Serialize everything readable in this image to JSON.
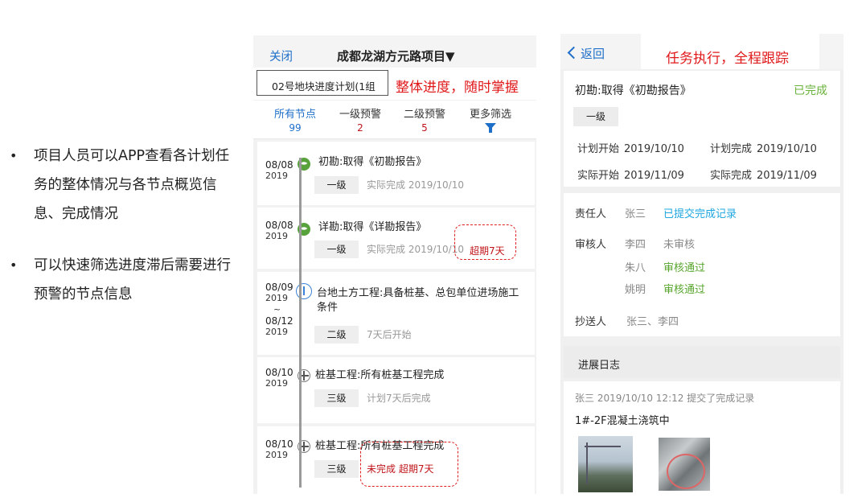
{
  "bullets": [
    {
      "text": "项目人员可以APP查看各计划任务的整体情况与各节点概览信息、完成情况"
    },
    {
      "text": "可以快速筛选进度滞后需要进行预警的节点信息"
    }
  ],
  "phone1": {
    "close": "关闭",
    "project_title": "成都龙湖方元路项目▼",
    "plan_select": "02号地块进度计划(1组",
    "callout": "整体进度，随时掌握",
    "filters": [
      {
        "label": "所有节点",
        "count": "99"
      },
      {
        "label": "一级预警",
        "count": "2"
      },
      {
        "label": "二级预警",
        "count": "5"
      },
      {
        "label": "更多筛选"
      }
    ],
    "tasks": [
      {
        "date": "08/08",
        "year": "2019",
        "name": "初勘:取得《初勘报告》",
        "level": "一级",
        "status": "实际完成 2019/10/10"
      },
      {
        "date": "08/08",
        "year": "2019",
        "name": "详勘:取得《详勘报告》",
        "level": "一级",
        "status": "实际完成 2019/10/10",
        "overdue": "超期7天"
      },
      {
        "date": "08/09",
        "year": "2019",
        "tilde": "~",
        "date_end": "08/12",
        "year_end": "2019",
        "name": "台地土方工程:具备桩基、总包单位进场施工条件",
        "level": "二级",
        "status": "7天后开始"
      },
      {
        "date": "08/10",
        "year": "2019",
        "name": "桩基工程:所有桩基工程完成",
        "level": "三级",
        "status": "计划7天后完成"
      },
      {
        "date": "08/10",
        "year": "2019",
        "name": "桩基工程:所有桩基工程完成",
        "level": "三级",
        "status": "未完成 超期7天"
      }
    ]
  },
  "phone2": {
    "back": "返回",
    "callout": "任务执行，全程跟踪",
    "task_title": "初勘:取得《初勘报告》",
    "task_status": "已完成",
    "level": "一级",
    "plan_start_label": "计划开始",
    "plan_start": "2019/10/10",
    "plan_end_label": "计划完成",
    "plan_end": "2019/10/10",
    "actual_start_label": "实际开始",
    "actual_start": "2019/11/09",
    "actual_end_label": "实际完成",
    "actual_end": "2019/11/09",
    "owner_label": "责任人",
    "owner": "张三",
    "owner_status": "已提交完成记录",
    "reviewer_label": "审核人",
    "reviewers": [
      {
        "name": "李四",
        "status": "未审核"
      },
      {
        "name": "朱八",
        "status": "审核通过"
      },
      {
        "name": "姚明",
        "status": "审核通过"
      }
    ],
    "cc_label": "抄送人",
    "cc": "张三、李四",
    "log_title": "进展日志",
    "log_meta": "张三 2019/10/10 12:12 提交了完成记录",
    "log_text": "1#-2F混凝土浇筑中"
  }
}
